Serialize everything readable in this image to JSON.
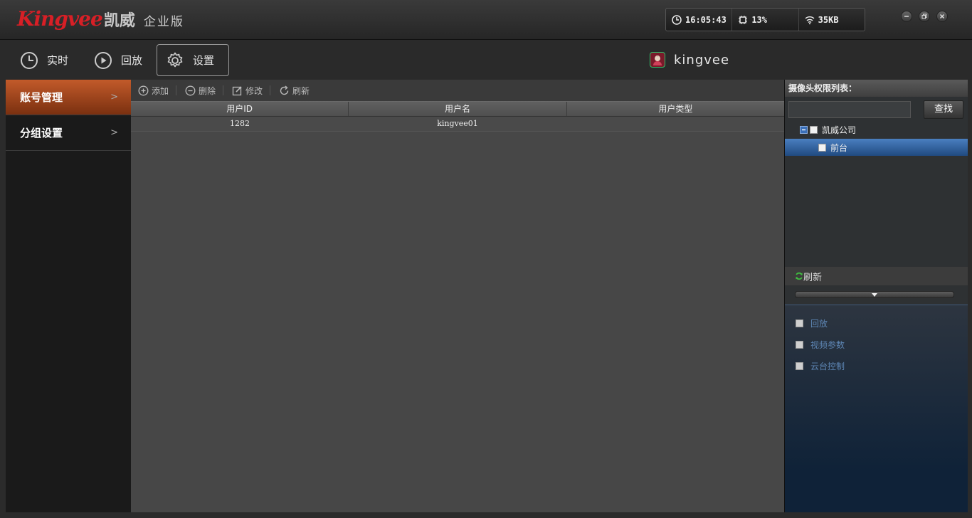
{
  "app": {
    "brand": "Kingvee",
    "brand_cn": "凯威",
    "edition": "企业版"
  },
  "status": {
    "time": "16:05:43",
    "cpu": "13%",
    "network": "35KB"
  },
  "nav": {
    "items": [
      {
        "label": "实时"
      },
      {
        "label": "回放"
      },
      {
        "label": "设置"
      }
    ],
    "active": "设置"
  },
  "user": {
    "name": "kingvee"
  },
  "sidebar": {
    "items": [
      {
        "label": "账号管理",
        "active": true
      },
      {
        "label": "分组设置",
        "active": false
      }
    ]
  },
  "toolbar": {
    "add": "添加",
    "delete": "删除",
    "edit": "修改",
    "refresh": "刷新"
  },
  "table": {
    "columns": [
      "用户ID",
      "用户名",
      "用户类型"
    ],
    "rows": [
      [
        "1282",
        "kingvee01",
        ""
      ]
    ]
  },
  "rightpanel": {
    "title": "摄像头权限列表：",
    "search_placeholder": "",
    "search_button": "查找",
    "tree": [
      {
        "label": "凯威公司",
        "selected": false
      },
      {
        "label": "前台",
        "selected": true
      }
    ],
    "refresh": "刷新",
    "permissions": [
      "回放",
      "视频参数",
      "云台控制"
    ]
  },
  "colors": {
    "brand_red": "#d81f26",
    "active_orange": "#c25a2a",
    "selected_blue": "#3a6fb8"
  }
}
